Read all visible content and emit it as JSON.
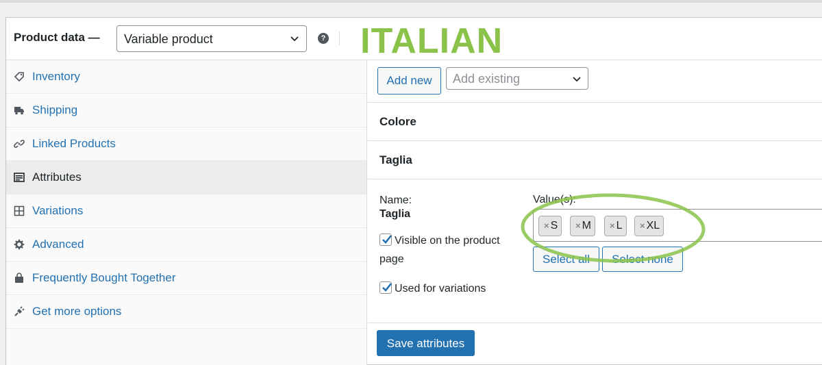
{
  "header": {
    "label": "Product data —",
    "product_type": "Variable product",
    "help_icon": "?",
    "overlay_text": "ITALIAN"
  },
  "sidebar": {
    "items": [
      {
        "label": "Inventory",
        "icon": "tag-icon"
      },
      {
        "label": "Shipping",
        "icon": "truck-icon"
      },
      {
        "label": "Linked Products",
        "icon": "link-icon"
      },
      {
        "label": "Attributes",
        "icon": "list-icon",
        "active": true
      },
      {
        "label": "Variations",
        "icon": "grid-icon"
      },
      {
        "label": "Advanced",
        "icon": "gear-icon"
      },
      {
        "label": "Frequently Bought Together",
        "icon": "bag-icon"
      },
      {
        "label": "Get more options",
        "icon": "plug-icon"
      }
    ]
  },
  "toolbar": {
    "add_new": "Add new",
    "add_existing_placeholder": "Add existing"
  },
  "attributes": [
    {
      "name": "Colore"
    },
    {
      "name": "Taglia"
    }
  ],
  "attribute_detail": {
    "name_label": "Name:",
    "name_value": "Taglia",
    "visible_label": "Visible on the product page",
    "visible_checked": true,
    "used_for_variations_label": "Used for variations",
    "used_checked": true,
    "values_label": "Value(s):",
    "values": [
      "S",
      "M",
      "L",
      "XL"
    ],
    "select_all": "Select all",
    "select_none": "Select none"
  },
  "save_button": "Save attributes",
  "colors": {
    "accent": "#2271b1",
    "highlight": "#8bc34a"
  }
}
